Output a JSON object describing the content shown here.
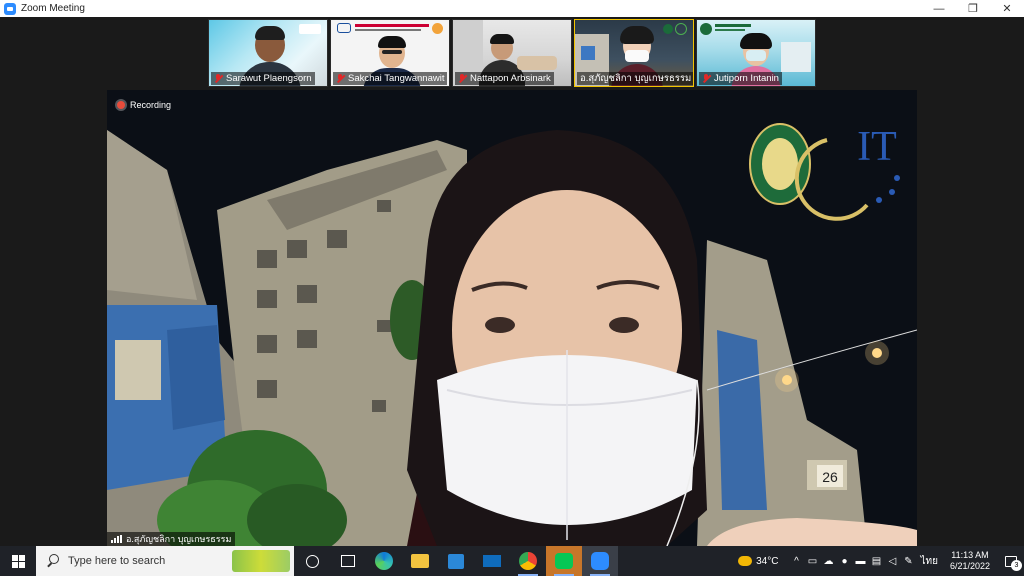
{
  "window": {
    "title": "Zoom Meeting",
    "controls": {
      "minimize": "—",
      "restore": "❐",
      "close": "✕"
    }
  },
  "participants": [
    {
      "name": "Sarawut Plaengsorn",
      "muted": true
    },
    {
      "name": "Sakchai Tangwannawit",
      "muted": true
    },
    {
      "name": "Nattapon Arbsinark",
      "muted": true
    },
    {
      "name": "อ.สุภัญชลิกา บุญเกษรธรรม",
      "muted": true
    },
    {
      "name": "Jutiporn Intanin",
      "muted": true
    }
  ],
  "main_video": {
    "recording_label": "Recording",
    "speaker_name": "อ.สุภัญชลิกา บุญเกษรธรรม",
    "logo_text": "IT",
    "building_number": "26"
  },
  "taskbar": {
    "search_placeholder": "Type here to search",
    "apps": [
      "task-view",
      "edge",
      "file-explorer",
      "store",
      "mail",
      "chrome",
      "line",
      "zoom"
    ],
    "weather": "34°C",
    "language": "ไทย",
    "time": "11:13 AM",
    "date": "6/21/2022",
    "notification_count": "3"
  },
  "colors": {
    "zoom_blue": "#2d8cff",
    "recording_red": "#e74c3c",
    "muted_red": "#e02828",
    "taskbar": "#1f2228"
  }
}
